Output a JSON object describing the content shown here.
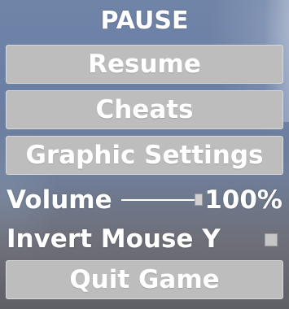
{
  "menu": {
    "title": "PAUSE",
    "buttons": {
      "resume": "Resume",
      "cheats": "Cheats",
      "graphics": "Graphic Settings",
      "quit": "Quit Game"
    }
  },
  "settings": {
    "volume": {
      "label": "Volume",
      "value_text": "100%",
      "level": 1.0
    },
    "invert_mouse_y": {
      "label": "Invert Mouse Y",
      "checked": false
    }
  }
}
